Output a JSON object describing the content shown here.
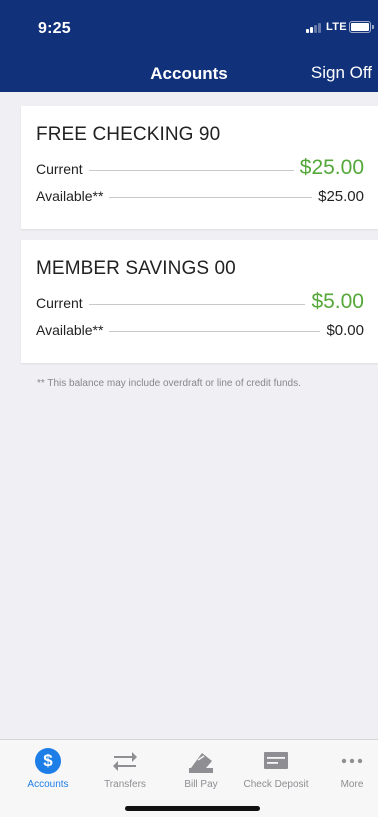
{
  "status_bar": {
    "time": "9:25",
    "network": "LTE"
  },
  "nav": {
    "title": "Accounts",
    "sign_off": "Sign Off"
  },
  "accounts": [
    {
      "name": "FREE CHECKING 90",
      "current_label": "Current",
      "current": "$25.00",
      "available_label": "Available**",
      "available": "$25.00"
    },
    {
      "name": "MEMBER SAVINGS 00",
      "current_label": "Current",
      "current": "$5.00",
      "available_label": "Available**",
      "available": "$0.00"
    }
  ],
  "footnote": "** This balance may include overdraft or line of credit funds.",
  "tabs": [
    {
      "label": "Accounts",
      "icon": "dollar-circle-icon",
      "active": true
    },
    {
      "label": "Transfers",
      "icon": "transfer-arrows-icon",
      "active": false
    },
    {
      "label": "Bill Pay",
      "icon": "bill-pay-icon",
      "active": false
    },
    {
      "label": "Check Deposit",
      "icon": "check-deposit-icon",
      "active": false
    },
    {
      "label": "More",
      "icon": "more-dots-icon",
      "active": false
    }
  ],
  "colors": {
    "header": "#11317a",
    "accent": "#1d7ee8",
    "current_balance": "#55a83a",
    "tab_inactive": "#8e8e93",
    "background": "#efeff4"
  }
}
